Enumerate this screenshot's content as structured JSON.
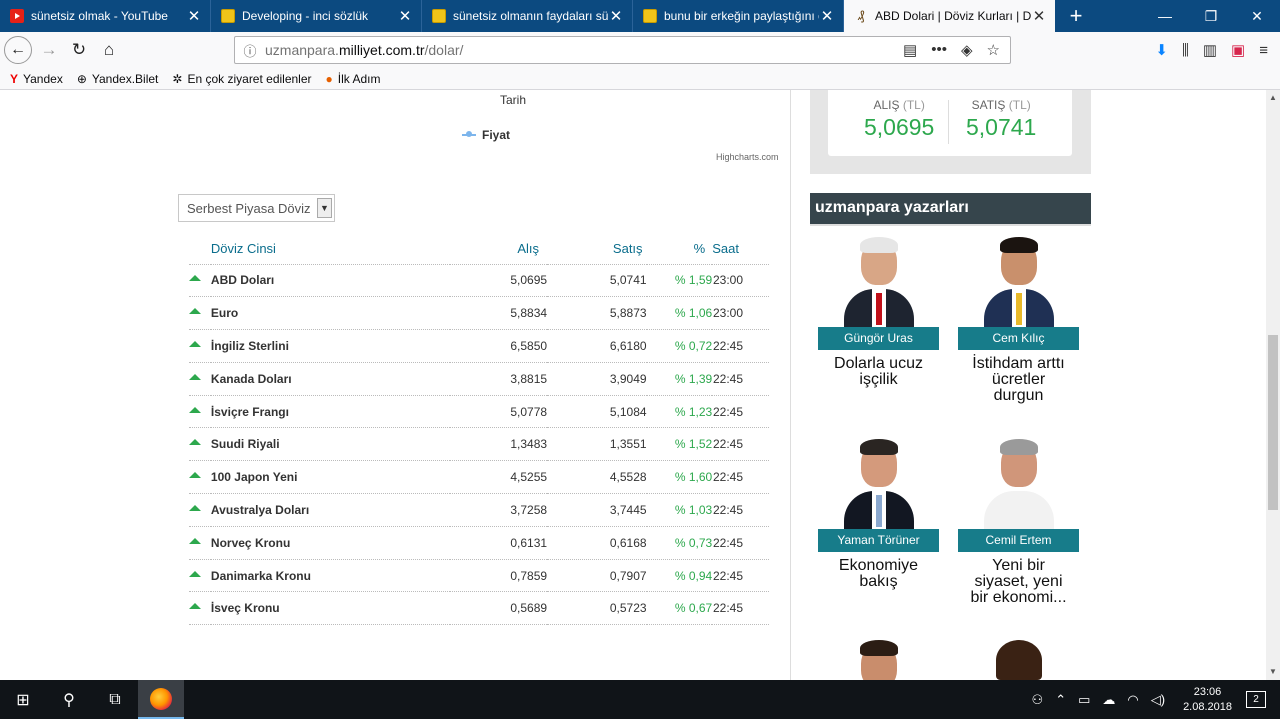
{
  "browser": {
    "tabs": [
      {
        "title": "sünetsiz olmak - YouTube",
        "icon": "youtube-icon",
        "active": false
      },
      {
        "title": "Developing - inci sözlük",
        "icon": "inci-sozluk-icon",
        "active": false
      },
      {
        "title": "sünetsiz olmanın faydaları süne",
        "icon": "inci-sozluk-icon",
        "active": false
      },
      {
        "title": "bunu bir erkeğin paylaştığını dü",
        "icon": "inci-sozluk-icon",
        "active": false
      },
      {
        "title": "ABD Dolari | Döviz Kurları | Dövi",
        "icon": "milliyet-icon",
        "active": true
      }
    ],
    "url_prefix": "uzmanpara.",
    "url_domain": "milliyet.com.tr",
    "url_path": "/dolar/",
    "bookmarks": [
      {
        "label": "Yandex",
        "icon": "yandex-icon"
      },
      {
        "label": "Yandex.Bilet",
        "icon": "globe-icon"
      },
      {
        "label": "En çok ziyaret edilenler",
        "icon": "gear-icon"
      },
      {
        "label": "İlk Adım",
        "icon": "firefox-icon"
      }
    ]
  },
  "chart": {
    "xlabel": "Tarih",
    "legend": "Fiyat",
    "credit": "Highcharts.com"
  },
  "market_select": {
    "selected": "Serbest Piyasa Döviz"
  },
  "currency_table": {
    "headers": [
      "Döviz Cinsi",
      "Alış",
      "Satış",
      "%",
      "Saat"
    ],
    "rows": [
      {
        "name": "ABD Doları",
        "buy": "5,0695",
        "sell": "5,0741",
        "pct": "% 1,59",
        "time": "23:00"
      },
      {
        "name": "Euro",
        "buy": "5,8834",
        "sell": "5,8873",
        "pct": "% 1,06",
        "time": "23:00"
      },
      {
        "name": "İngiliz Sterlini",
        "buy": "6,5850",
        "sell": "6,6180",
        "pct": "% 0,72",
        "time": "22:45"
      },
      {
        "name": "Kanada Doları",
        "buy": "3,8815",
        "sell": "3,9049",
        "pct": "% 1,39",
        "time": "22:45"
      },
      {
        "name": "İsviçre Frangı",
        "buy": "5,0778",
        "sell": "5,1084",
        "pct": "% 1,23",
        "time": "22:45"
      },
      {
        "name": "Suudi Riyali",
        "buy": "1,3483",
        "sell": "1,3551",
        "pct": "% 1,52",
        "time": "22:45"
      },
      {
        "name": "100 Japon Yeni",
        "buy": "4,5255",
        "sell": "4,5528",
        "pct": "% 1,60",
        "time": "22:45"
      },
      {
        "name": "Avustralya Doları",
        "buy": "3,7258",
        "sell": "3,7445",
        "pct": "% 1,03",
        "time": "22:45"
      },
      {
        "name": "Norveç Kronu",
        "buy": "0,6131",
        "sell": "0,6168",
        "pct": "% 0,73",
        "time": "22:45"
      },
      {
        "name": "Danimarka Kronu",
        "buy": "0,7859",
        "sell": "0,7907",
        "pct": "% 0,94",
        "time": "22:45"
      },
      {
        "name": "İsveç Kronu",
        "buy": "0,5689",
        "sell": "0,5723",
        "pct": "% 0,67",
        "time": "22:45"
      }
    ]
  },
  "rate_box": {
    "buy_label": "ALIŞ",
    "sell_label": "SATIŞ",
    "unit": "(TL)",
    "buy_value": "5,0695",
    "sell_value": "5,0741"
  },
  "writers_section": {
    "title": "uzmanpara yazarları",
    "writers": [
      {
        "name": "Güngör Uras",
        "article": "Dolarla ucuz işçilik"
      },
      {
        "name": "Cem Kılıç",
        "article": "İstihdam arttı ücretler durgun"
      },
      {
        "name": "Yaman Törüner",
        "article": "Ekonomiye bakış"
      },
      {
        "name": "Cemil Ertem",
        "article": "Yeni bir siyaset, yeni bir ekonomi..."
      }
    ]
  },
  "taskbar": {
    "time": "23:06",
    "date": "2.08.2018",
    "notifications": "2"
  },
  "colors": {
    "tabstrip": "#0c4a80",
    "up_green": "#2da84d",
    "header_teal": "#0a6d8c",
    "writer_name_bg": "#177c8a",
    "section_bar": "#36454c"
  }
}
